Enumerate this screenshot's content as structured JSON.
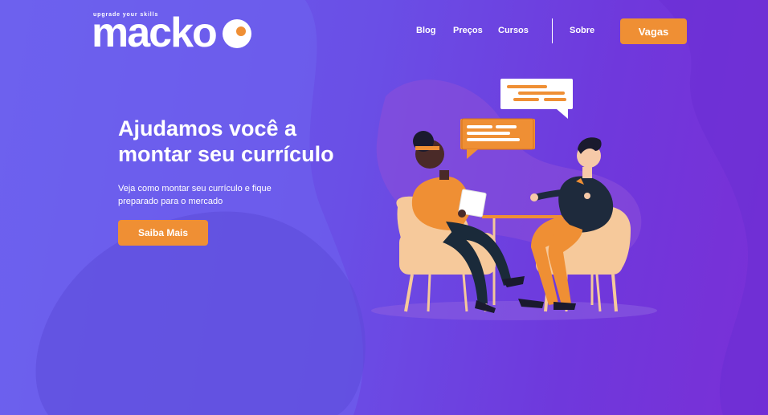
{
  "brand": {
    "name": "macko",
    "tagline": "upgrade your skills"
  },
  "nav": {
    "blog": "Blog",
    "precos": "Preços",
    "cursos": "Cursos",
    "sobre": "Sobre",
    "vagas": "Vagas"
  },
  "hero": {
    "title_line1": "Ajudamos você a",
    "title_line2": "montar seu currículo",
    "subtitle_line1": "Veja como montar seu currículo e fique",
    "subtitle_line2": "preparado para o mercado",
    "cta": "Saiba Mais"
  },
  "colors": {
    "accent": "#ef8f34",
    "background_start": "#6d5eee",
    "background_end": "#7a2fd6"
  },
  "icons": {
    "illustration": "interview-illustration",
    "speech_bubble_left": "speech-bubble-icon",
    "speech_bubble_right": "speech-bubble-icon"
  }
}
